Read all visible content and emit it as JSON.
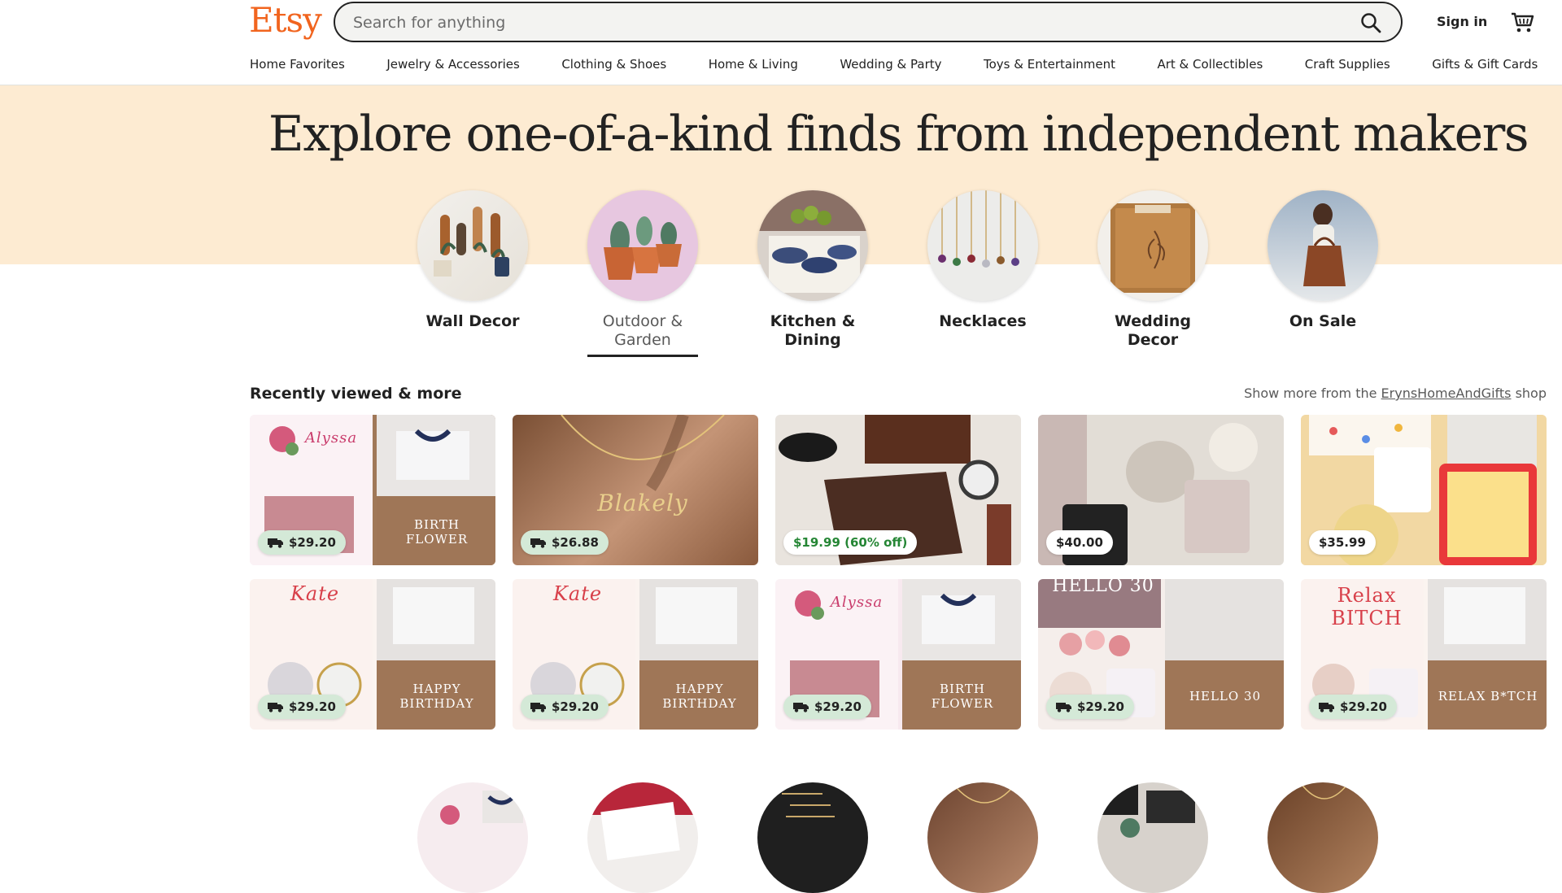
{
  "header": {
    "logo": "Etsy",
    "search_placeholder": "Search for anything",
    "sign_in": "Sign in"
  },
  "nav": [
    "Home Favorites",
    "Jewelry & Accessories",
    "Clothing & Shoes",
    "Home & Living",
    "Wedding & Party",
    "Toys & Entertainment",
    "Art & Collectibles",
    "Craft Supplies",
    "Gifts & Gift Cards"
  ],
  "hero": {
    "title": "Explore one-of-a-kind finds from independent makers",
    "categories": [
      "Wall Decor",
      "Outdoor & Garden",
      "Kitchen & Dining",
      "Necklaces",
      "Wedding Decor",
      "On Sale"
    ],
    "active_category": "Outdoor & Garden"
  },
  "recent": {
    "title": "Recently viewed & more",
    "more_prefix": "Show more from the",
    "more_link": "ErynsHomeAndGifts",
    "more_suffix": "shop",
    "items": [
      {
        "price": "$29.20",
        "free_shipping": true,
        "overlay": "BIRTH FLOWER",
        "title_text": "Alyssa"
      },
      {
        "price": "$26.88",
        "free_shipping": true,
        "overlay": "",
        "title_text": "Blakely"
      },
      {
        "price": "$19.99 (60% off)",
        "free_shipping": false,
        "overlay": "",
        "title_text": ""
      },
      {
        "price": "$40.00",
        "free_shipping": false,
        "overlay": "",
        "title_text": ""
      },
      {
        "price": "$35.99",
        "free_shipping": false,
        "overlay": "",
        "title_text": ""
      },
      {
        "price": "$29.20",
        "free_shipping": true,
        "overlay": "HAPPY BIRTHDAY",
        "title_text": "Kate"
      },
      {
        "price": "$29.20",
        "free_shipping": true,
        "overlay": "HAPPY BIRTHDAY",
        "title_text": "Kate"
      },
      {
        "price": "$29.20",
        "free_shipping": true,
        "overlay": "BIRTH FLOWER",
        "title_text": "Alyssa"
      },
      {
        "price": "$29.20",
        "free_shipping": true,
        "overlay": "HELLO 30",
        "title_text": "HELLO 30"
      },
      {
        "price": "$29.20",
        "free_shipping": true,
        "overlay": "RELAX B*TCH",
        "title_text": "Relax BITCH"
      }
    ]
  },
  "colors": {
    "brand": "#f1641e",
    "hero_bg": "#fdebd2",
    "ship_badge": "#d4e9d7",
    "sale_text": "#258635"
  },
  "icons": {
    "search": "search-icon",
    "cart": "cart-icon",
    "truck": "truck-icon"
  }
}
